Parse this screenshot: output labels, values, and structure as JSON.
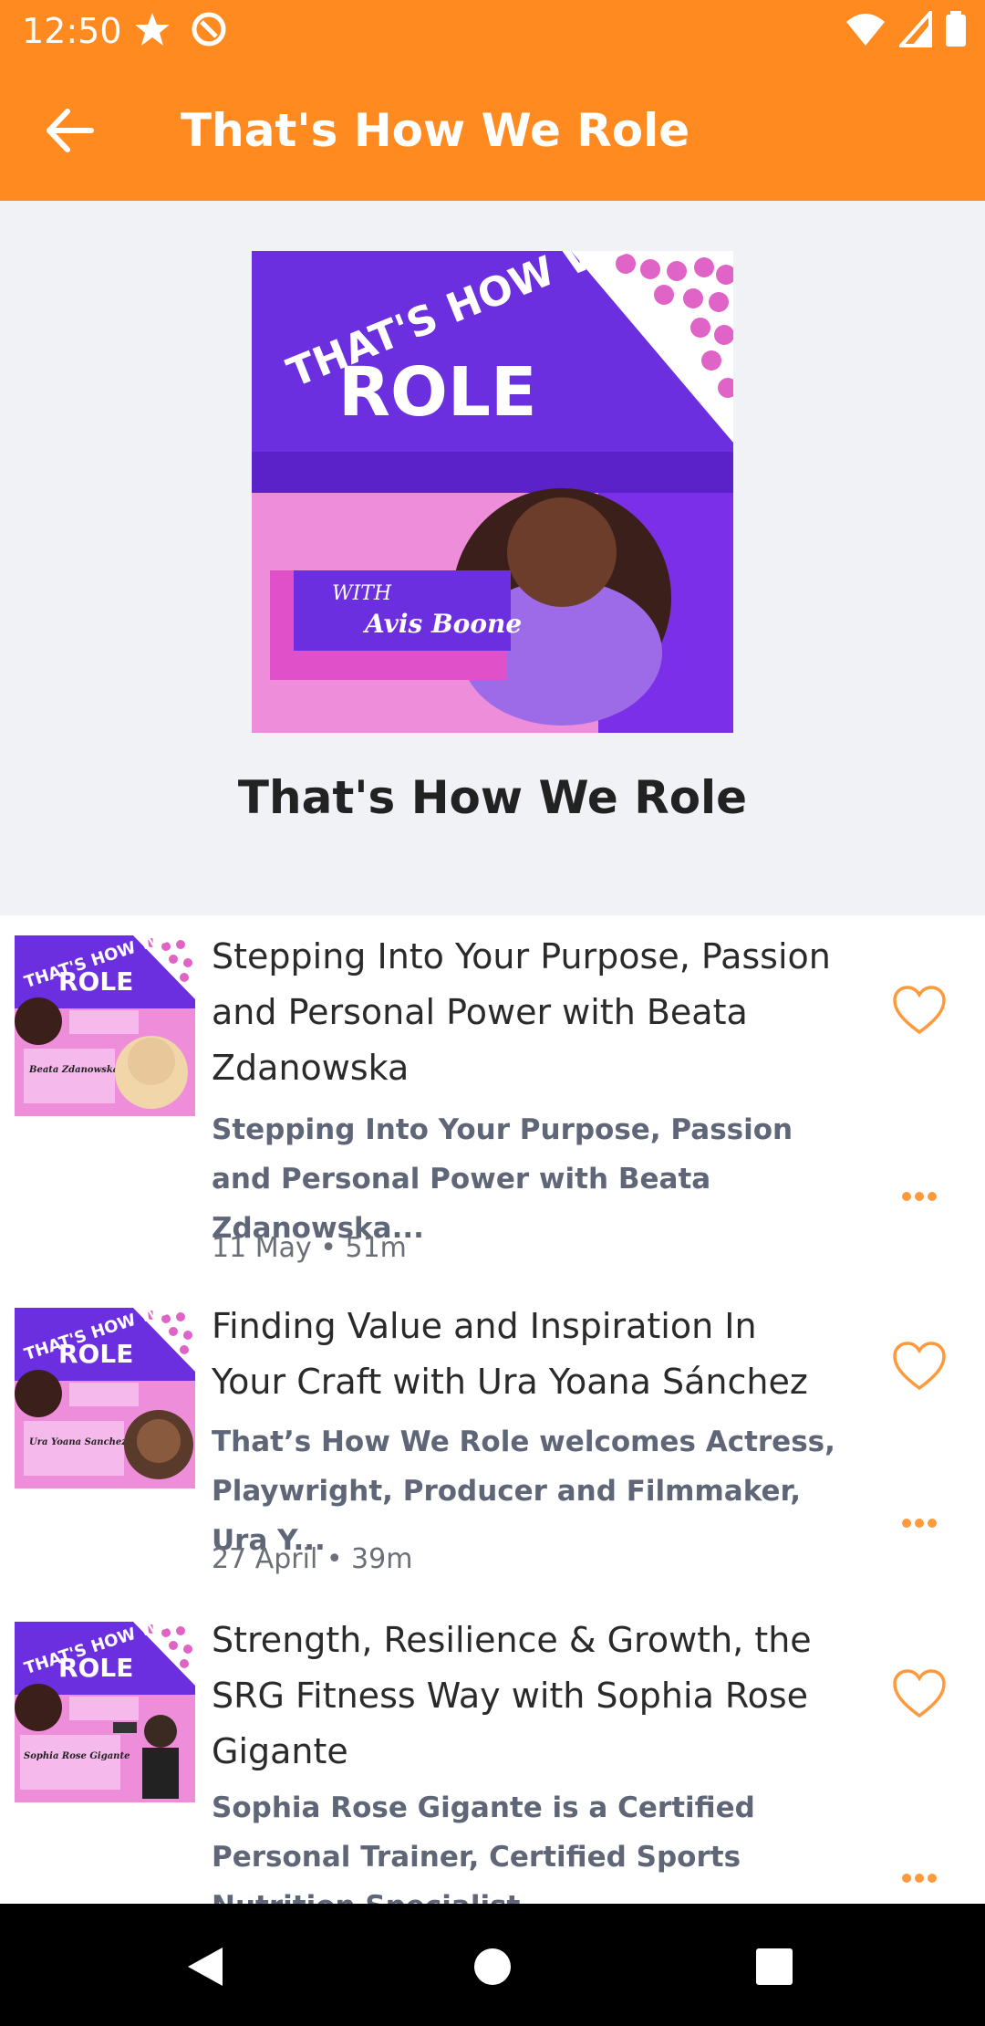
{
  "status": {
    "time": "12:50"
  },
  "app_bar": {
    "title": "That's How We Role"
  },
  "show": {
    "title": "That's How We Role",
    "cover_text": {
      "top": "THAT'S HOW WE",
      "big": "ROLE",
      "with": "WITH",
      "host": "Avis Boone"
    }
  },
  "episodes": [
    {
      "title": "Stepping Into Your Purpose, Passion and Personal Power with Beata Zdanowska",
      "description": "Stepping Into Your Purpose, Passion and Personal Power with Beata Zdanowska...",
      "meta": "11 May • 51m",
      "thumb_guest": "Beata Zdanowska"
    },
    {
      "title": "Finding Value and Inspiration In Your Craft with Ura Yoana Sánchez",
      "description": " That’s How We Role welcomes Actress, Playwright, Producer and Filmmaker, Ura Y...",
      "meta": "27 April • 39m",
      "thumb_guest": "Ura Yoana Sanchez"
    },
    {
      "title": "Strength, Resilience & Growth, the SRG Fitness Way  with Sophia Rose Gigante",
      "description": "Sophia Rose Gigante is a Certified Personal Trainer, Certified Sports Nutrition Specialist,...",
      "meta": "",
      "thumb_guest": "Sophia Rose Gigante"
    }
  ],
  "colors": {
    "accent": "#FF8A1F",
    "header_bg": "#F1F2F6",
    "purple": "#6B2FE0",
    "pink": "#EE8EDB"
  }
}
